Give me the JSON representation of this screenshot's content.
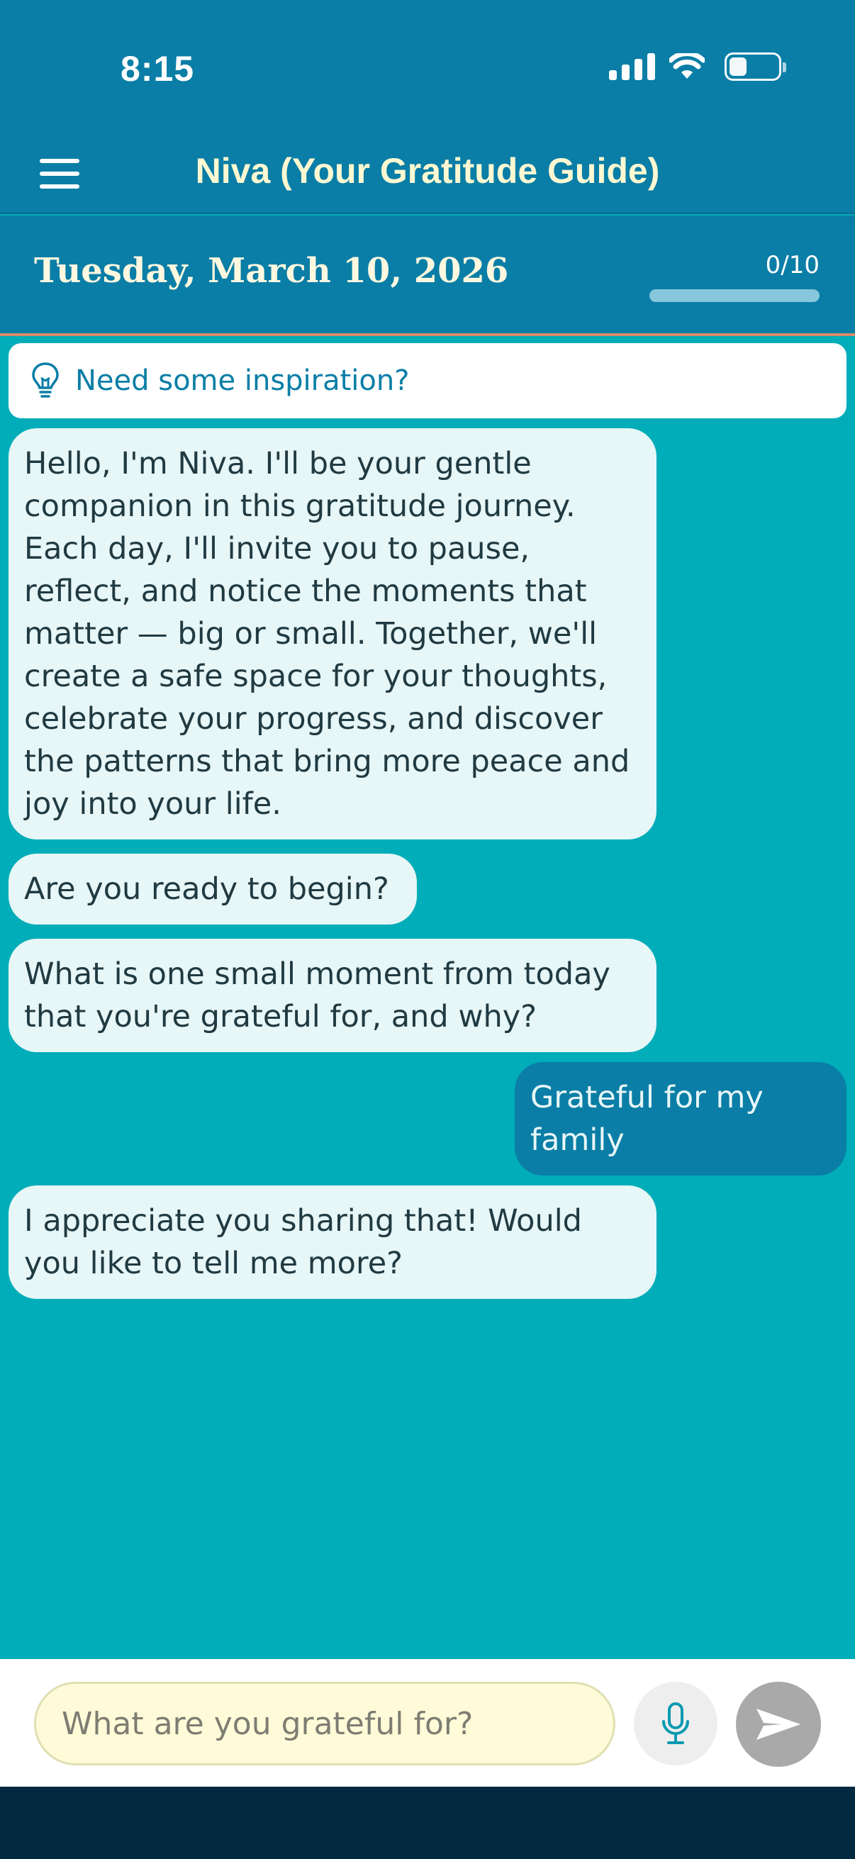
{
  "status": {
    "time": "8:15"
  },
  "header": {
    "title": "Niva (Your Gratitude Guide)"
  },
  "date_bar": {
    "date": "Tuesday, March 10, 2026",
    "progress_text": "0/10",
    "progress_value": 0
  },
  "inspiration": {
    "label": "Need some inspiration?"
  },
  "messages": [
    {
      "sender": "bot",
      "text": "Hello, I'm Niva. I'll be your gentle companion in this gratitude journey. Each day, I'll invite you to pause, reflect, and notice the moments that matter — big or small. Together, we'll create a safe space for your thoughts, celebrate your progress, and discover the patterns that bring more peace and joy into your life."
    },
    {
      "sender": "bot",
      "text": "Are you ready to begin?"
    },
    {
      "sender": "bot",
      "text": "What is one small moment from today that you're grateful for, and why?"
    },
    {
      "sender": "user",
      "text": "Grateful for my family"
    },
    {
      "sender": "bot",
      "text": "I appreciate you sharing that! Would you like to tell me more?"
    }
  ],
  "input": {
    "placeholder": "What are you grateful for?"
  },
  "icons": {
    "menu": "menu-icon",
    "bulb": "lightbulb-icon",
    "mic": "microphone-icon",
    "send": "send-icon"
  },
  "colors": {
    "primary": "#0a7ea6",
    "background": "#00adb8",
    "bot_bubble": "#e7f6f6",
    "input_bg": "#fffbd8"
  }
}
